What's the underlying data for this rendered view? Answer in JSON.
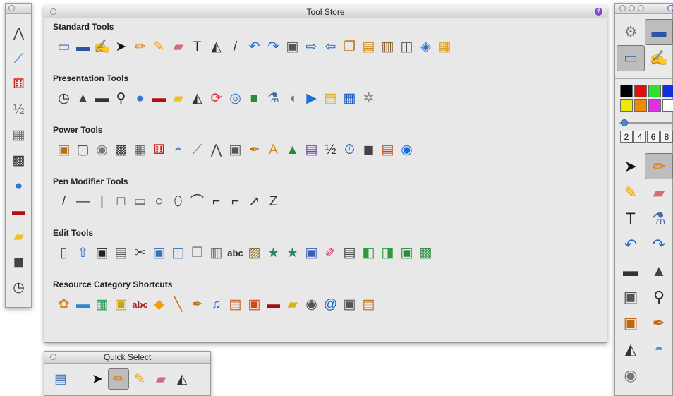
{
  "tool_store": {
    "title": "Tool Store",
    "help_label": "?",
    "sections": [
      {
        "title": "Standard Tools",
        "tools": [
          {
            "name": "screen-capture-icon",
            "glyph": "▭",
            "color": "#3a6fb5"
          },
          {
            "name": "file-menu-icon",
            "glyph": "▬",
            "color": "#2b56a6"
          },
          {
            "name": "pen-canvas-icon",
            "glyph": "✍",
            "color": "#1f4aa0"
          },
          {
            "name": "select-arrow-icon",
            "glyph": "➤",
            "color": "#111111"
          },
          {
            "name": "pencil-icon",
            "glyph": "✏",
            "color": "#e07a00"
          },
          {
            "name": "highlighter-icon",
            "glyph": "✎",
            "color": "#f0a100"
          },
          {
            "name": "eraser-icon",
            "glyph": "▰",
            "color": "#d46a7a"
          },
          {
            "name": "text-icon",
            "glyph": "T",
            "color": "#222222"
          },
          {
            "name": "paint-bucket-icon",
            "glyph": "◭",
            "color": "#333333"
          },
          {
            "name": "dropper-icon",
            "glyph": "/",
            "color": "#333333"
          },
          {
            "name": "undo-icon",
            "glyph": "↶",
            "color": "#1e6fd6"
          },
          {
            "name": "redo-icon",
            "glyph": "↷",
            "color": "#1e6fd6"
          },
          {
            "name": "camera-icon",
            "glyph": "▣",
            "color": "#555555"
          },
          {
            "name": "next-page-icon",
            "glyph": "⇨",
            "color": "#1a66c8"
          },
          {
            "name": "previous-page-icon",
            "glyph": "⇦",
            "color": "#1a66c8"
          },
          {
            "name": "page-sorter-icon",
            "glyph": "❐",
            "color": "#c07a2a"
          },
          {
            "name": "resource-browser-icon",
            "glyph": "▤",
            "color": "#d08a1a"
          },
          {
            "name": "library-icon",
            "glyph": "▥",
            "color": "#8a5a2a"
          },
          {
            "name": "property-browser-icon",
            "glyph": "◫",
            "color": "#555555"
          },
          {
            "name": "notes-browser-icon",
            "glyph": "◈",
            "color": "#2e73c9"
          },
          {
            "name": "flipchart-icon",
            "glyph": "▦",
            "color": "#d9a020"
          }
        ]
      },
      {
        "title": "Presentation Tools",
        "tools": [
          {
            "name": "clock-icon",
            "glyph": "◷",
            "color": "#333333"
          },
          {
            "name": "spotlight-icon",
            "glyph": "▲",
            "color": "#444444"
          },
          {
            "name": "reveal-blind-icon",
            "glyph": "▬",
            "color": "#333333"
          },
          {
            "name": "magnifier-icon",
            "glyph": "⚲",
            "color": "#2b2b2b"
          },
          {
            "name": "globe-icon",
            "glyph": "●",
            "color": "#2b78d6"
          },
          {
            "name": "ticker-tape-icon",
            "glyph": "▬",
            "color": "#b01010"
          },
          {
            "name": "sticky-note-icon",
            "glyph": "▰",
            "color": "#f0c020"
          },
          {
            "name": "sound-recorder-icon",
            "glyph": "◭",
            "color": "#333333"
          },
          {
            "name": "refresh-icon",
            "glyph": "⟳",
            "color": "#d03030"
          },
          {
            "name": "rotate-icon",
            "glyph": "◎",
            "color": "#2e73c9"
          },
          {
            "name": "green-square-icon",
            "glyph": "■",
            "color": "#2a8a3a"
          },
          {
            "name": "flask-icon",
            "glyph": "⚗",
            "color": "#4a6aa0"
          },
          {
            "name": "mouse-icon",
            "glyph": "◖",
            "color": "#777777"
          },
          {
            "name": "play-icon",
            "glyph": "▶",
            "color": "#1a6fd6"
          },
          {
            "name": "note-pad-icon",
            "glyph": "▤",
            "color": "#e0b020"
          },
          {
            "name": "table-icon",
            "glyph": "▦",
            "color": "#1a5fc0"
          },
          {
            "name": "gear-outline-icon",
            "glyph": "✲",
            "color": "#8a8a8a"
          }
        ]
      },
      {
        "title": "Power Tools",
        "tools": [
          {
            "name": "desktop-annotate-icon",
            "glyph": "▣",
            "color": "#c06a10"
          },
          {
            "name": "desktop-tools-icon",
            "glyph": "▢",
            "color": "#444444"
          },
          {
            "name": "compass-icon",
            "glyph": "◉",
            "color": "#777777"
          },
          {
            "name": "dice-grid-icon",
            "glyph": "▩",
            "color": "#333333"
          },
          {
            "name": "calculator-icon",
            "glyph": "▦",
            "color": "#666666"
          },
          {
            "name": "dice-icon",
            "glyph": "⚅",
            "color": "#d22020"
          },
          {
            "name": "protractor-icon",
            "glyph": "◓",
            "color": "#5a8ad0"
          },
          {
            "name": "ruler-icon",
            "glyph": "⟋",
            "color": "#3a7ad0"
          },
          {
            "name": "compass-draw-icon",
            "glyph": "⋀",
            "color": "#444444"
          },
          {
            "name": "contact-icon",
            "glyph": "▣",
            "color": "#555555"
          },
          {
            "name": "handwriting-recognition-icon",
            "glyph": "✒",
            "color": "#c06a10"
          },
          {
            "name": "text-recognition-icon",
            "glyph": "A",
            "color": "#d08a1a"
          },
          {
            "name": "shape-recognition-icon",
            "glyph": "▲",
            "color": "#2a8a3a"
          },
          {
            "name": "date-time-icon",
            "glyph": "▤",
            "color": "#6a4aa0"
          },
          {
            "name": "fraction-icon",
            "glyph": "½",
            "color": "#333333"
          },
          {
            "name": "timer-icon",
            "glyph": "⏱",
            "color": "#2a5fb0"
          },
          {
            "name": "video-camera-icon",
            "glyph": "◼",
            "color": "#444444"
          },
          {
            "name": "ruled-notes-icon",
            "glyph": "▤",
            "color": "#c04a10"
          },
          {
            "name": "media-icon",
            "glyph": "◉",
            "color": "#1a6fd6"
          }
        ]
      },
      {
        "title": "Pen Modifier Tools",
        "tools": [
          {
            "name": "diagonal-line-icon",
            "glyph": "/",
            "color": "#333333"
          },
          {
            "name": "horizontal-line-icon",
            "glyph": "—",
            "color": "#333333"
          },
          {
            "name": "vertical-line-icon",
            "glyph": "|",
            "color": "#333333"
          },
          {
            "name": "square-icon",
            "glyph": "□",
            "color": "#333333"
          },
          {
            "name": "rectangle-icon",
            "glyph": "▭",
            "color": "#333333"
          },
          {
            "name": "circle-icon",
            "glyph": "○",
            "color": "#333333"
          },
          {
            "name": "ellipse-icon",
            "glyph": "⬯",
            "color": "#333333"
          },
          {
            "name": "arc-icon",
            "glyph": "⌒",
            "color": "#333333"
          },
          {
            "name": "curve-icon",
            "glyph": "⌐",
            "color": "#333333"
          },
          {
            "name": "connector-icon",
            "glyph": "⌐",
            "color": "#333333"
          },
          {
            "name": "arrow-line-icon",
            "glyph": "↗",
            "color": "#333333"
          },
          {
            "name": "zigzag-icon",
            "glyph": "Z",
            "color": "#333333"
          }
        ]
      },
      {
        "title": "Edit Tools",
        "tools": [
          {
            "name": "new-page-icon",
            "glyph": "▯",
            "color": "#555555"
          },
          {
            "name": "open-icon",
            "glyph": "⇧",
            "color": "#2a7ad0"
          },
          {
            "name": "save-icon",
            "glyph": "▣",
            "color": "#222222"
          },
          {
            "name": "print-icon",
            "glyph": "▤",
            "color": "#555555"
          },
          {
            "name": "cut-icon",
            "glyph": "✂",
            "color": "#333333"
          },
          {
            "name": "paste-icon",
            "glyph": "▣",
            "color": "#3a6fb5"
          },
          {
            "name": "copy-page-icon",
            "glyph": "◫",
            "color": "#3a6fb5"
          },
          {
            "name": "duplicate-icon",
            "glyph": "❐",
            "color": "#888888"
          },
          {
            "name": "trash-icon",
            "glyph": "▥",
            "color": "#666666"
          },
          {
            "name": "spell-check-icon",
            "glyph": "abc",
            "color": "#333333"
          },
          {
            "name": "select-all-icon",
            "glyph": "▨",
            "color": "#8a6a2a"
          },
          {
            "name": "star-bigger-icon",
            "glyph": "★",
            "color": "#2a8a5a"
          },
          {
            "name": "star-smaller-icon",
            "glyph": "★",
            "color": "#2a8a5a"
          },
          {
            "name": "clipboard-icon",
            "glyph": "▣",
            "color": "#3a5fb0"
          },
          {
            "name": "magic-pen-icon",
            "glyph": "✐",
            "color": "#d02a6a"
          },
          {
            "name": "clear-page-icon",
            "glyph": "▤",
            "color": "#444444"
          },
          {
            "name": "bring-front-icon",
            "glyph": "◧",
            "color": "#2a9a3a"
          },
          {
            "name": "send-back-icon",
            "glyph": "◨",
            "color": "#2a9a3a"
          },
          {
            "name": "group-icon",
            "glyph": "▣",
            "color": "#2a8a3a"
          },
          {
            "name": "ungroup-icon",
            "glyph": "▩",
            "color": "#2a8a3a"
          }
        ]
      },
      {
        "title": "Resource Category Shortcuts",
        "tools": [
          {
            "name": "images-category-icon",
            "glyph": "✿",
            "color": "#d08a10"
          },
          {
            "name": "backgrounds-category-icon",
            "glyph": "▬",
            "color": "#2a8ad0"
          },
          {
            "name": "grids-category-icon",
            "glyph": "▦",
            "color": "#2a9a5a"
          },
          {
            "name": "frames-category-icon",
            "glyph": "▣",
            "color": "#d0a010"
          },
          {
            "name": "text-category-icon",
            "glyph": "abc",
            "color": "#b01a1a"
          },
          {
            "name": "shapes-category-icon",
            "glyph": "◆",
            "color": "#f0a000"
          },
          {
            "name": "lines-category-icon",
            "glyph": "╲",
            "color": "#c07010"
          },
          {
            "name": "annotations-category-icon",
            "glyph": "✒",
            "color": "#c08010"
          },
          {
            "name": "sounds-category-icon",
            "glyph": "♫",
            "color": "#2a6ad0"
          },
          {
            "name": "pages-category-icon",
            "glyph": "▤",
            "color": "#c06020"
          },
          {
            "name": "notes-category-icon",
            "glyph": "▣",
            "color": "#d04a10"
          },
          {
            "name": "ticker-category-icon",
            "glyph": "▬",
            "color": "#a01010"
          },
          {
            "name": "stickies-category-icon",
            "glyph": "▰",
            "color": "#e0b010"
          },
          {
            "name": "media-category-icon",
            "glyph": "◉",
            "color": "#555555"
          },
          {
            "name": "links-category-icon",
            "glyph": "@",
            "color": "#1a6ad0"
          },
          {
            "name": "activities-category-icon",
            "glyph": "▣",
            "color": "#555555"
          },
          {
            "name": "assessment-category-icon",
            "glyph": "▤",
            "color": "#c07010"
          }
        ]
      }
    ]
  },
  "left_toolbox": {
    "tools": [
      {
        "name": "compass-draw-icon",
        "glyph": "⋀",
        "color": "#444444"
      },
      {
        "name": "ruler-icon",
        "glyph": "⟋",
        "color": "#3a7ad0"
      },
      {
        "name": "dice-icon",
        "glyph": "⚅",
        "color": "#d22020"
      },
      {
        "name": "fraction-icon",
        "glyph": "½",
        "color": "#777777"
      },
      {
        "name": "calculator-icon",
        "glyph": "▦",
        "color": "#666666"
      },
      {
        "name": "dice-grid-icon",
        "glyph": "▩",
        "color": "#333333"
      },
      {
        "name": "globe-icon",
        "glyph": "●",
        "color": "#2b78d6"
      },
      {
        "name": "ticker-tape-icon",
        "glyph": "▬",
        "color": "#b01010"
      },
      {
        "name": "sticky-note-icon",
        "glyph": "▰",
        "color": "#f0c020"
      },
      {
        "name": "video-camera-icon",
        "glyph": "◼",
        "color": "#444444"
      },
      {
        "name": "clock-icon",
        "glyph": "◷",
        "color": "#333333"
      }
    ]
  },
  "quick_select": {
    "title": "Quick Select",
    "tools": [
      {
        "name": "page-list-icon",
        "glyph": "▤",
        "color": "#3a6fb5"
      },
      {
        "name": "select-arrow-icon",
        "glyph": "➤",
        "color": "#111111"
      },
      {
        "name": "pencil-icon",
        "glyph": "✏",
        "color": "#e07a00",
        "selected": true
      },
      {
        "name": "highlighter-icon",
        "glyph": "✎",
        "color": "#f0a100"
      },
      {
        "name": "eraser-icon",
        "glyph": "▰",
        "color": "#d46a7a"
      },
      {
        "name": "paint-bucket-icon",
        "glyph": "◭",
        "color": "#333333"
      }
    ]
  },
  "main_toolbox": {
    "top_tools": [
      {
        "name": "settings-gear-icon",
        "glyph": "⚙",
        "color": "#777777"
      },
      {
        "name": "file-menu-icon",
        "glyph": "▬",
        "color": "#2b56a6",
        "selected": true
      },
      {
        "name": "screen-capture-icon",
        "glyph": "▭",
        "color": "#3a6fb5",
        "selected": true
      },
      {
        "name": "pen-canvas-icon",
        "glyph": "✍",
        "color": "#1f4aa0"
      }
    ],
    "colors": [
      "#000000",
      "#e01010",
      "#30e030",
      "#1030e0",
      "#f0e800",
      "#f08a00",
      "#e030e0",
      "#ffffff"
    ],
    "widths": [
      "2",
      "4",
      "6",
      "8"
    ],
    "tools": [
      {
        "name": "select-arrow-icon",
        "glyph": "➤",
        "color": "#111111"
      },
      {
        "name": "pencil-icon",
        "glyph": "✏",
        "color": "#e07a00",
        "selected": true
      },
      {
        "name": "highlighter-icon",
        "glyph": "✎",
        "color": "#f0a100"
      },
      {
        "name": "eraser-icon",
        "glyph": "▰",
        "color": "#d46a7a"
      },
      {
        "name": "text-icon",
        "glyph": "T",
        "color": "#222222"
      },
      {
        "name": "flask-icon",
        "glyph": "⚗",
        "color": "#4a6aa0"
      },
      {
        "name": "undo-icon",
        "glyph": "↶",
        "color": "#1e6fd6"
      },
      {
        "name": "redo-icon",
        "glyph": "↷",
        "color": "#1e6fd6"
      },
      {
        "name": "reveal-blind-icon",
        "glyph": "▬",
        "color": "#333333"
      },
      {
        "name": "spotlight-icon",
        "glyph": "▲",
        "color": "#444444"
      },
      {
        "name": "camera-icon",
        "glyph": "▣",
        "color": "#555555"
      },
      {
        "name": "magnifier-icon",
        "glyph": "⚲",
        "color": "#2b2b2b"
      },
      {
        "name": "desktop-annotate-icon",
        "glyph": "▣",
        "color": "#c06a10"
      },
      {
        "name": "handwriting-recognition-icon",
        "glyph": "✒",
        "color": "#c06a10"
      },
      {
        "name": "paint-bucket-icon",
        "glyph": "◭",
        "color": "#333333"
      },
      {
        "name": "protractor-icon",
        "glyph": "◓",
        "color": "#5a8ad0"
      },
      {
        "name": "compass-icon",
        "glyph": "◉",
        "color": "#777777"
      }
    ]
  }
}
